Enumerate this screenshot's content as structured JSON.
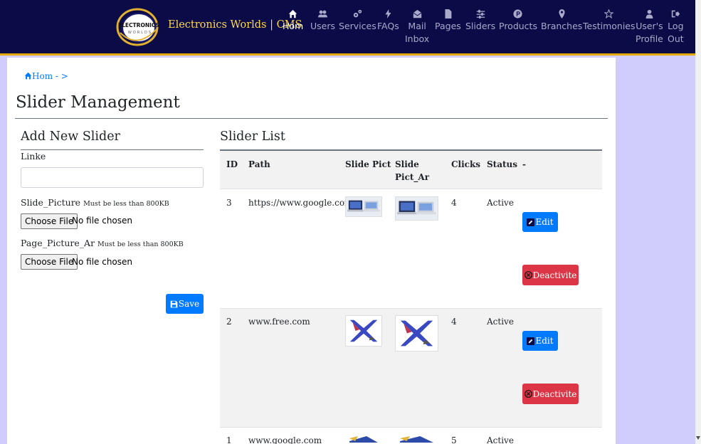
{
  "brand": {
    "logo_text": "ELECTRONICS",
    "logo_subtext": "WORLDS",
    "title": "Electronics Worlds | CMS"
  },
  "nav": [
    {
      "label": "Hom",
      "icon": "home-icon",
      "active": true
    },
    {
      "label": "Users",
      "icon": "users-icon",
      "active": false
    },
    {
      "label": "Services",
      "icon": "cogs-icon",
      "active": false
    },
    {
      "label": "FAQs",
      "icon": "bolt-icon",
      "active": false
    },
    {
      "label": "Mail\nInbox",
      "icon": "envelope-open-icon",
      "active": false
    },
    {
      "label": "Pages",
      "icon": "file-icon",
      "active": false
    },
    {
      "label": "Sliders",
      "icon": "sliders-icon",
      "active": false
    },
    {
      "label": "Products",
      "icon": "product-hunt-icon",
      "active": false
    },
    {
      "label": "Branches",
      "icon": "map-marker-icon",
      "active": false
    },
    {
      "label": "Testimonies",
      "icon": "star-icon",
      "active": false
    },
    {
      "label": "User's\nProfile",
      "icon": "user-icon",
      "active": false
    },
    {
      "label": "Log\nOut",
      "icon": "sign-out-icon",
      "active": false
    }
  ],
  "breadcrumb": {
    "home": "Hom - >"
  },
  "page_title": "Slider Management",
  "form": {
    "title": "Add New Slider",
    "link_label": "Linke",
    "link_value": "",
    "slide_picture_label": "Slide_Picture",
    "slide_picture_note": "Must be less than 800KB",
    "page_picture_ar_label": "Page_Picture_Ar",
    "page_picture_ar_note": "Must be less than 800KB",
    "choose_file": "Choose File",
    "no_file": "No file chosen",
    "save_label": "Save"
  },
  "table": {
    "title": "Slider List",
    "columns": [
      "ID",
      "Path",
      "Slide Pict",
      "Slide\nPict_Ar",
      "Clicks",
      "Status",
      "-"
    ],
    "edit_label": "Edit",
    "deactivate_label": "Deactivite",
    "rows": [
      {
        "id": "3",
        "path": "https://www.google.com",
        "clicks": "4",
        "status": "Active",
        "image": "laptop-image"
      },
      {
        "id": "2",
        "path": "www.free.com",
        "clicks": "4",
        "status": "Active",
        "image": "phones-x-image"
      },
      {
        "id": "1",
        "path": "www.google.com",
        "clicks": "5",
        "status": "Active",
        "image": "banner-image"
      }
    ]
  },
  "colors": {
    "navbar": "#0b0b48",
    "brand": "#ffd84d",
    "accent_border": "#e0a800",
    "primary": "#007bff",
    "danger": "#dc3545",
    "page_bg": "#d0ccfb"
  }
}
